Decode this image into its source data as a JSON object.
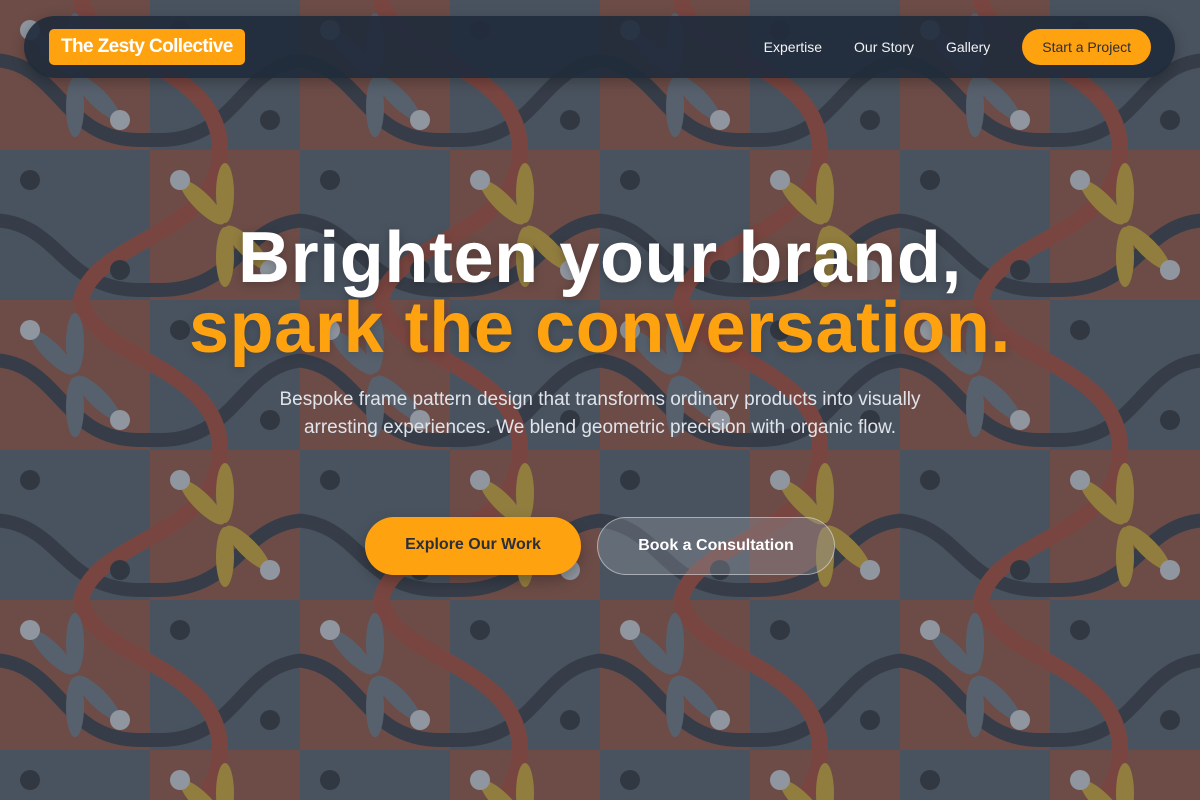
{
  "brand": {
    "name": "The Zesty Collective"
  },
  "nav": {
    "links": [
      "Expertise",
      "Our Story",
      "Gallery"
    ],
    "cta_label": "Start a Project"
  },
  "hero": {
    "headline_line1": "Brighten your brand,",
    "headline_line2": "spark the conversation.",
    "subtitle": "Bespoke frame pattern design that transforms ordinary products into visually arresting experiences. We blend geometric precision with organic flow.",
    "primary_button": "Explore Our Work",
    "secondary_button": "Book a Consultation"
  },
  "colors": {
    "accent": "#ffa20f",
    "nav_background": "#212b3c",
    "pattern_red": "#a24a3b",
    "pattern_slate": "#4e5866",
    "pattern_yellow": "#d7b02c"
  }
}
